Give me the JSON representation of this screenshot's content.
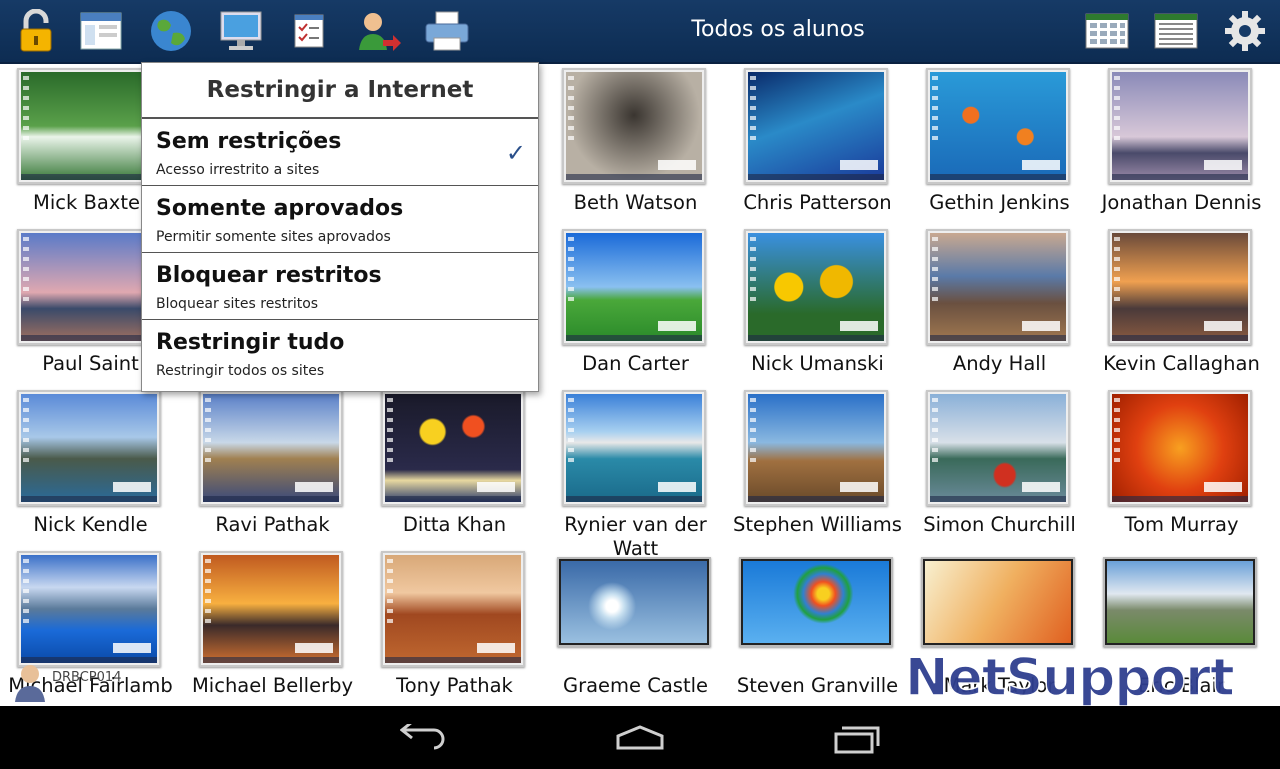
{
  "toolbar": {
    "title": "Todos os alunos",
    "icons": [
      "lock-icon",
      "window-icon",
      "globe-icon",
      "monitor-icon",
      "checklist-icon",
      "user-transfer-icon",
      "printer-icon",
      "thumbnail-grid-icon",
      "list-view-icon",
      "gear-icon"
    ]
  },
  "menu": {
    "title": "Restringir a Internet",
    "options": [
      {
        "title": "Sem restrições",
        "subtitle": "Acesso irrestrito a sites",
        "selected": true
      },
      {
        "title": "Somente aprovados",
        "subtitle": "Permitir somente sites aprovados",
        "selected": false
      },
      {
        "title": "Bloquear restritos",
        "subtitle": "Bloquear sites restritos",
        "selected": false
      },
      {
        "title": "Restringir tudo",
        "subtitle": "Restringir todos os sites",
        "selected": false
      }
    ],
    "check_mark": "✓"
  },
  "students": [
    {
      "name": "Mick Baxter"
    },
    {
      "name": "Beth Watson"
    },
    {
      "name": "Chris Patterson"
    },
    {
      "name": "Gethin Jenkins"
    },
    {
      "name": "Jonathan Dennis"
    },
    {
      "name": "Paul Saint"
    },
    {
      "name": "Dan Carter"
    },
    {
      "name": "Nick Umanski"
    },
    {
      "name": "Andy Hall"
    },
    {
      "name": "Kevin Callaghan"
    },
    {
      "name": "Nick Kendle"
    },
    {
      "name": "Ravi Pathak"
    },
    {
      "name": "Ditta Khan"
    },
    {
      "name": "Rynier van der Watt"
    },
    {
      "name": "Stephen Williams"
    },
    {
      "name": "Simon Churchill"
    },
    {
      "name": "Tom Murray"
    },
    {
      "name": "Michael Fairlamb"
    },
    {
      "name": "Michael Bellerby"
    },
    {
      "name": "Tony Pathak"
    },
    {
      "name": "Graeme Castle"
    },
    {
      "name": "Steven Granville"
    },
    {
      "name": "Mark Taylor"
    },
    {
      "name": "Eric Blair"
    }
  ],
  "tutor": {
    "label": "DRBCP014"
  },
  "logo": {
    "text": "NetSupport"
  },
  "colors": {
    "toolbar": "#0d2c52",
    "menu_check": "#2a4f8a",
    "logo": "#2f3f8f"
  }
}
